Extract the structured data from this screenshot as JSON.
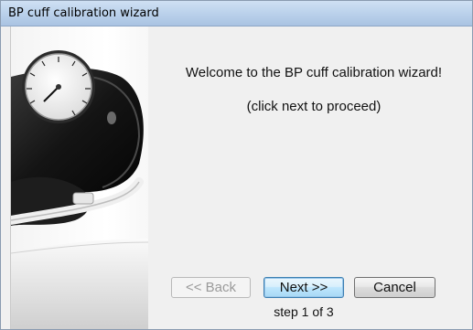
{
  "window": {
    "title": "BP cuff calibration wizard"
  },
  "hero": {
    "image": "blood-pressure-cuff-with-gauge"
  },
  "content": {
    "welcome": "Welcome to the BP cuff calibration wizard!",
    "hint": "(click next to proceed)"
  },
  "buttons": {
    "back": "<< Back",
    "next": "Next >>",
    "cancel": "Cancel"
  },
  "progress": {
    "text": "step 1 of 3",
    "current_step": 1,
    "total_steps": 3
  }
}
